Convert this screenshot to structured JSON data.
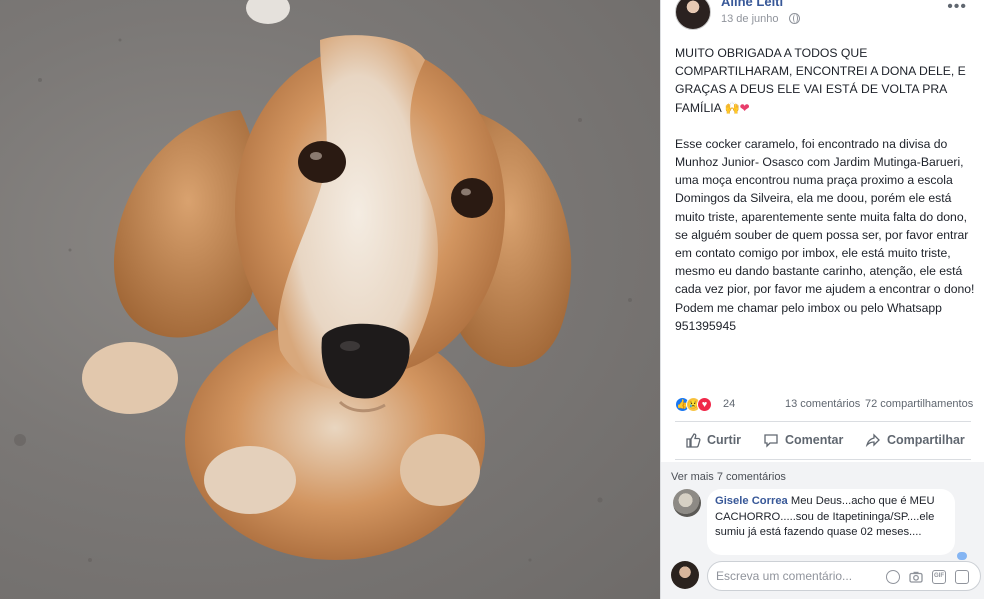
{
  "post": {
    "author": "Aline Leiti",
    "date": "13 de junho",
    "text_p1": "MUITO OBRIGADA A TODOS QUE COMPARTILHARAM, ENCONTREI A DONA DELE, E GRAÇAS A DEUS ELE VAI ESTÁ DE VOLTA PRA FAMÍLIA",
    "text_p1_emoji_hands": "🙌",
    "text_p1_emoji_heart": "❤",
    "text_p2": "Esse cocker caramelo, foi encontrado na divisa do Munhoz Junior- Osasco com Jardim Mutinga-Barueri, uma moça encontrou numa praça proximo a escola Domingos da Silveira, ela me doou, porém ele está muito triste, aparentemente sente muita falta do dono, se alguém souber de quem possa ser, por favor entrar em contato comigo por imbox, ele está muito triste, mesmo eu dando bastante carinho, atenção, ele está cada vez pior, por favor me ajudem a encontrar o dono!",
    "text_p3": "Podem me chamar pelo imbox ou pelo Whatsapp 951395945"
  },
  "stats": {
    "reactions_count": "24",
    "comments": "13 comentários",
    "shares": "72 compartilhamentos",
    "reaction_icons": [
      "like-icon",
      "sad-icon",
      "love-icon"
    ]
  },
  "actions": {
    "like": "Curtir",
    "comment": "Comentar",
    "share": "Compartilhar"
  },
  "comments": {
    "see_more": "Ver mais 7 comentários",
    "items": [
      {
        "name": "Gisele Correa",
        "text": "Meu Deus...acho que é MEU CACHORRO.....sou de Itapetininga/SP....ele sumiu já está fazendo quase 02 meses...."
      }
    ],
    "write_placeholder": "Escreva um comentário...",
    "composer_icons": [
      "emoji-icon",
      "camera-icon",
      "gif-icon",
      "sticker-icon"
    ]
  },
  "colors": {
    "link": "#385898",
    "like": "#1877f2",
    "love": "#f0284a",
    "sad": "#f7c547"
  }
}
